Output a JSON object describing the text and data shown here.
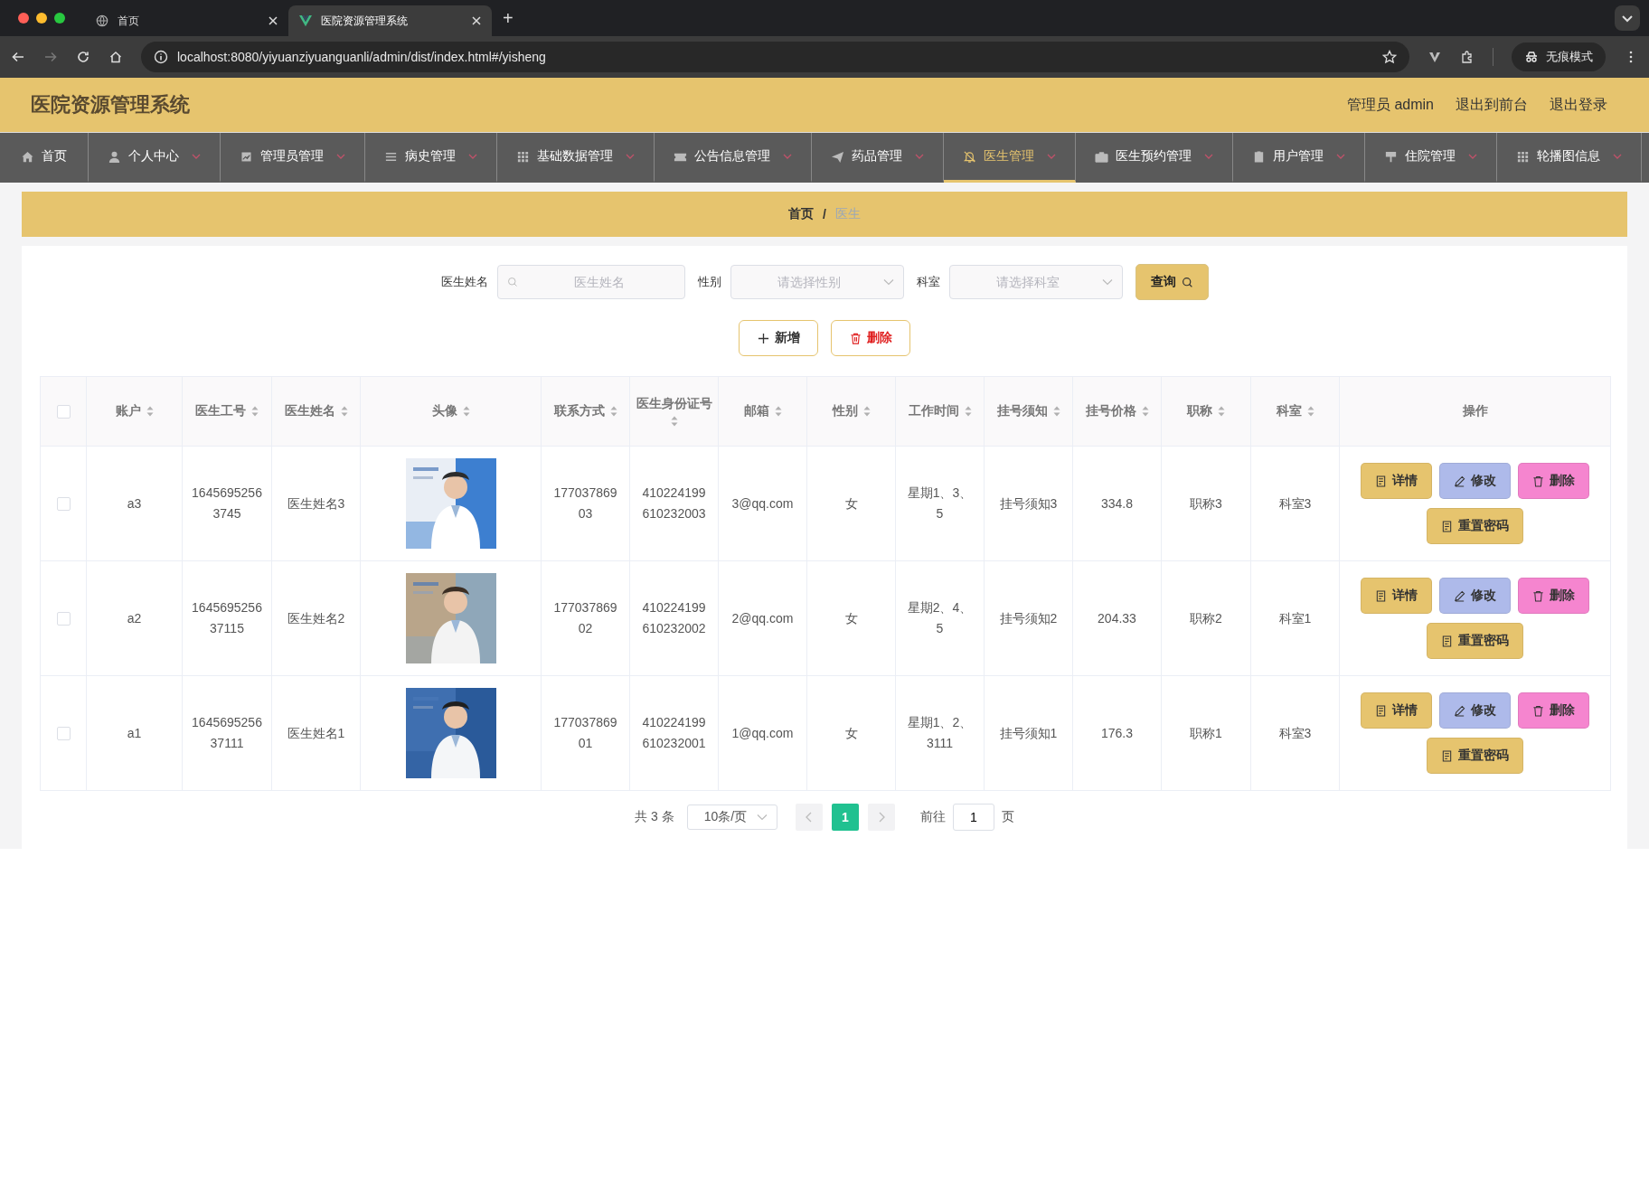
{
  "browser": {
    "tabs": [
      {
        "title": "首页",
        "selected": false,
        "kind": "globe"
      },
      {
        "title": "医院资源管理系统",
        "selected": true,
        "kind": "vue"
      }
    ],
    "new_tab": "+",
    "url": "localhost:8080/yiyuanziyuanguanli/admin/dist/index.html#/yisheng",
    "incognito": "无痕模式"
  },
  "header": {
    "title": "医院资源管理系统",
    "links": [
      "管理员 admin",
      "退出到前台",
      "退出登录"
    ]
  },
  "nav": [
    {
      "label": "首页",
      "selected": false,
      "dropdown": false
    },
    {
      "label": "个人中心",
      "selected": false,
      "dropdown": true
    },
    {
      "label": "管理员管理",
      "selected": false,
      "dropdown": true
    },
    {
      "label": "病史管理",
      "selected": false,
      "dropdown": true
    },
    {
      "label": "基础数据管理",
      "selected": false,
      "dropdown": true
    },
    {
      "label": "公告信息管理",
      "selected": false,
      "dropdown": true
    },
    {
      "label": "药品管理",
      "selected": false,
      "dropdown": true
    },
    {
      "label": "医生管理",
      "selected": true,
      "dropdown": true
    },
    {
      "label": "医生预约管理",
      "selected": false,
      "dropdown": true
    },
    {
      "label": "用户管理",
      "selected": false,
      "dropdown": true
    },
    {
      "label": "住院管理",
      "selected": false,
      "dropdown": true
    },
    {
      "label": "轮播图信息",
      "selected": false,
      "dropdown": true
    }
  ],
  "breadcrumb": [
    {
      "label": "首页",
      "selected": false
    },
    {
      "label": "医生",
      "selected": true
    }
  ],
  "breadcrumb_separator": "/",
  "search": {
    "fields": [
      {
        "label": "医生姓名",
        "placeholder": "医生姓名",
        "kind": "input"
      },
      {
        "label": "性别",
        "placeholder": "请选择性别",
        "kind": "select"
      },
      {
        "label": "科室",
        "placeholder": "请选择科室",
        "kind": "select"
      }
    ],
    "button": "查询"
  },
  "toolbar": [
    {
      "label": "新增",
      "kind": "add"
    },
    {
      "label": "删除",
      "kind": "delete"
    }
  ],
  "table": {
    "select_all_checked": false,
    "columns": [
      {
        "label": "账户",
        "sortable": true
      },
      {
        "label": "医生工号",
        "sortable": true
      },
      {
        "label": "医生姓名",
        "sortable": true
      },
      {
        "label": "头像",
        "sortable": true
      },
      {
        "label": "联系方式",
        "sortable": true
      },
      {
        "label": "医生身份证号",
        "sortable": true
      },
      {
        "label": "邮箱",
        "sortable": true
      },
      {
        "label": "性别",
        "sortable": true
      },
      {
        "label": "工作时间",
        "sortable": true
      },
      {
        "label": "挂号须知",
        "sortable": true
      },
      {
        "label": "挂号价格",
        "sortable": true
      },
      {
        "label": "职称",
        "sortable": true
      },
      {
        "label": "科室",
        "sortable": true
      },
      {
        "label": "操作",
        "sortable": false
      }
    ],
    "rows": [
      {
        "checked": false,
        "cells": [
          "a3",
          "16456952563745",
          "医生姓名3",
          null,
          "17703786903",
          "410224199610232003",
          "3@qq.com",
          "女",
          "星期1、3、5",
          "挂号须知3",
          "334.8",
          "职称3",
          "科室3"
        ],
        "actions": [
          {
            "label": "详情",
            "kind": "detail"
          },
          {
            "label": "修改",
            "kind": "edit"
          },
          {
            "label": "删除",
            "kind": "delete"
          },
          {
            "label": "重置密码",
            "kind": "reset"
          }
        ]
      },
      {
        "checked": false,
        "cells": [
          "a2",
          "164569525637115",
          "医生姓名2",
          null,
          "17703786902",
          "410224199610232002",
          "2@qq.com",
          "女",
          "星期2、4、5",
          "挂号须知2",
          "204.33",
          "职称2",
          "科室1"
        ],
        "actions": [
          {
            "label": "详情",
            "kind": "detail"
          },
          {
            "label": "修改",
            "kind": "edit"
          },
          {
            "label": "删除",
            "kind": "delete"
          },
          {
            "label": "重置密码",
            "kind": "reset"
          }
        ]
      },
      {
        "checked": false,
        "cells": [
          "a1",
          "164569525637111",
          "医生姓名1",
          null,
          "17703786901",
          "410224199610232001",
          "1@qq.com",
          "女",
          "星期1、2、3111",
          "挂号须知1",
          "176.3",
          "职称1",
          "科室3"
        ],
        "actions": [
          {
            "label": "详情",
            "kind": "detail"
          },
          {
            "label": "修改",
            "kind": "edit"
          },
          {
            "label": "删除",
            "kind": "delete"
          },
          {
            "label": "重置密码",
            "kind": "reset"
          }
        ]
      }
    ]
  },
  "pagination": {
    "total": "共 3 条",
    "page_size": "10条/页",
    "pages": [
      {
        "label": "1",
        "selected": true
      }
    ],
    "goto_label": "前往",
    "goto_value": "1",
    "goto_suffix": "页"
  }
}
